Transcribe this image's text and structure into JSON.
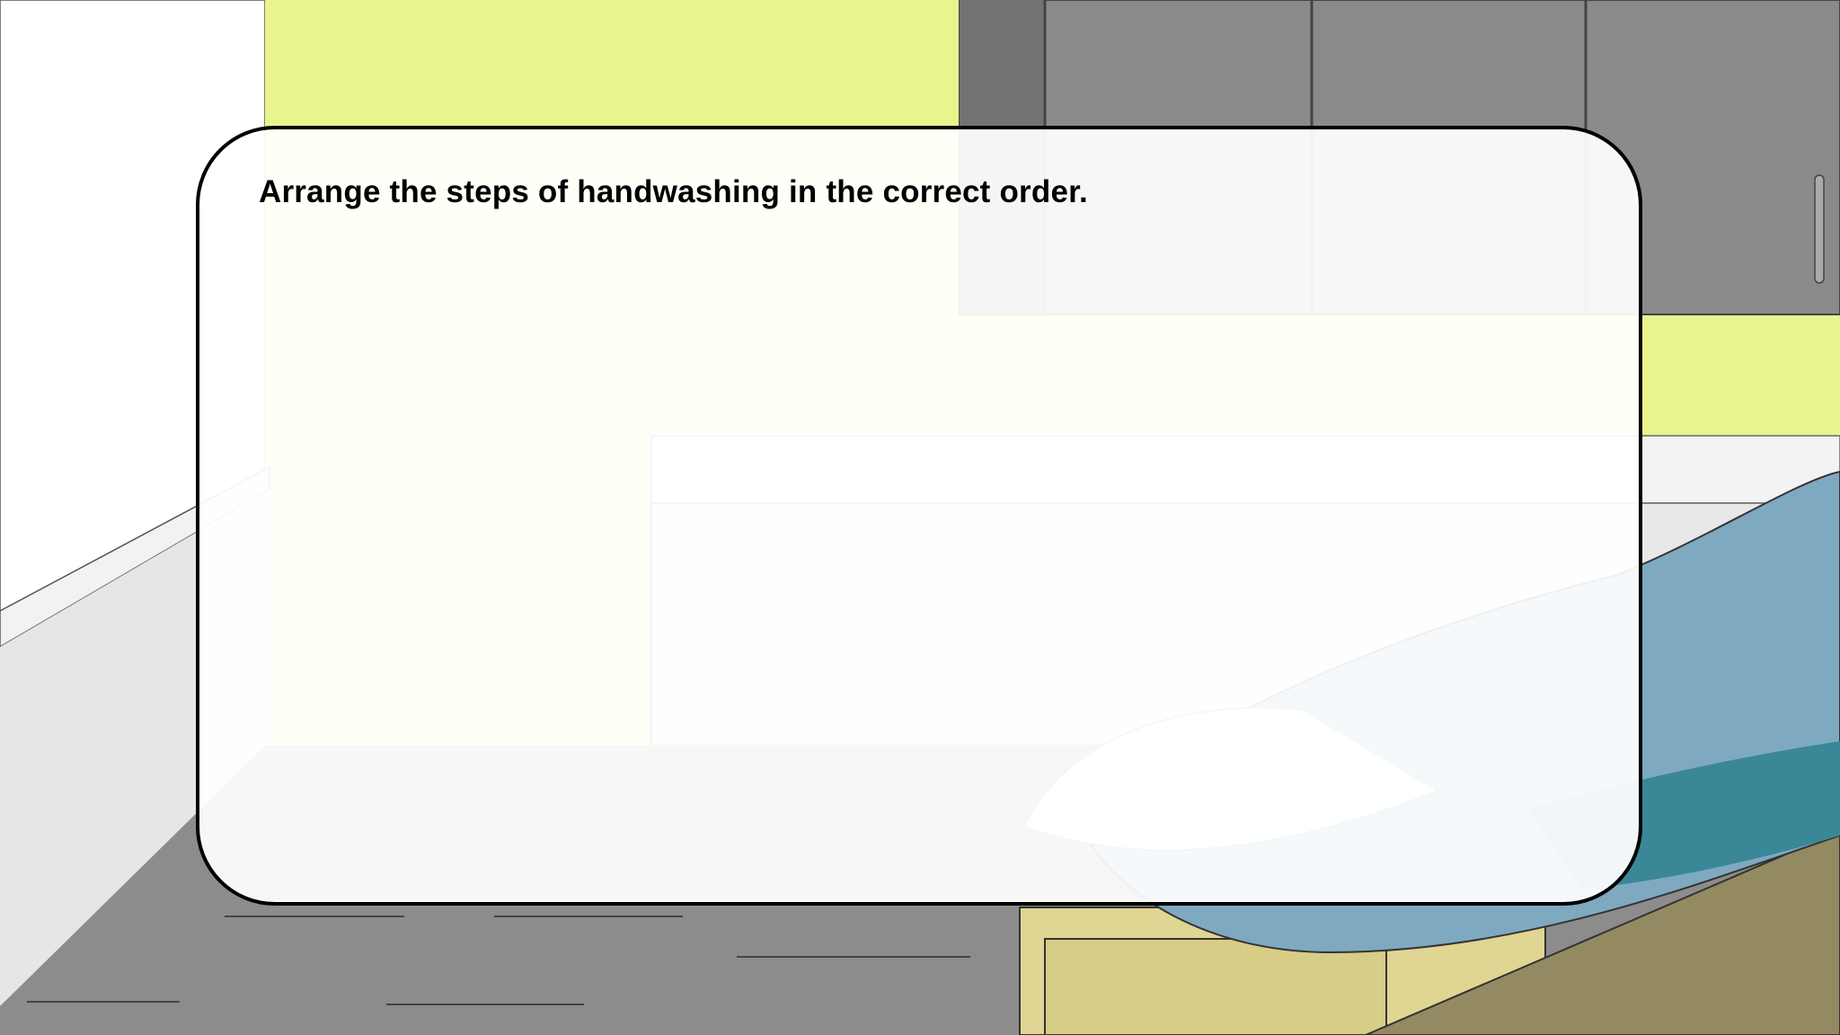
{
  "activity": {
    "instruction": "Arrange the steps of handwashing in the correct order."
  },
  "scene": {
    "wall_color": "#e9f58c",
    "cabinet_color": "#8a8a8a",
    "floor_color": "#8c8c8c",
    "exam_table_cushion_color": "#7fa9c0",
    "exam_table_base_color": "#e0d593"
  }
}
